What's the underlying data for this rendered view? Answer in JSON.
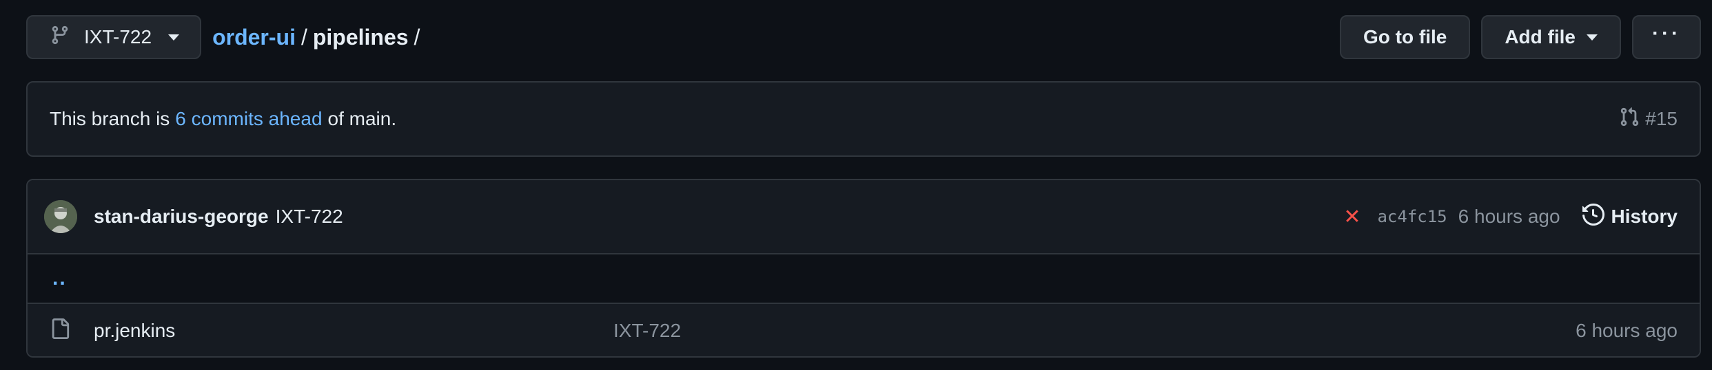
{
  "branch": {
    "name": "IXT-722",
    "icon": "git-branch-icon"
  },
  "breadcrumb": {
    "repo": "order-ui",
    "sep1": "/",
    "dir": "pipelines",
    "sep2": "/"
  },
  "actions": {
    "go_to_file": "Go to file",
    "add_file": "Add file",
    "more": "···"
  },
  "banner": {
    "prefix": "This branch is",
    "link": "6 commits ahead",
    "suffix": "of main.",
    "pr_label": "#15"
  },
  "latest_commit": {
    "author": "stan-darius-george",
    "message": "IXT-722",
    "status_icon": "x-icon",
    "status_color": "#f85149",
    "sha": "ac4fc15",
    "time": "6 hours ago",
    "history_label": "History"
  },
  "parent_dir": "..",
  "files": [
    {
      "name": "pr.jenkins",
      "message": "IXT-722",
      "time": "6 hours ago",
      "icon": "file-icon"
    }
  ],
  "colors": {
    "accent": "#6cb6ff",
    "bg": "#0d1117",
    "panel": "#161b22",
    "border": "#30363d"
  }
}
